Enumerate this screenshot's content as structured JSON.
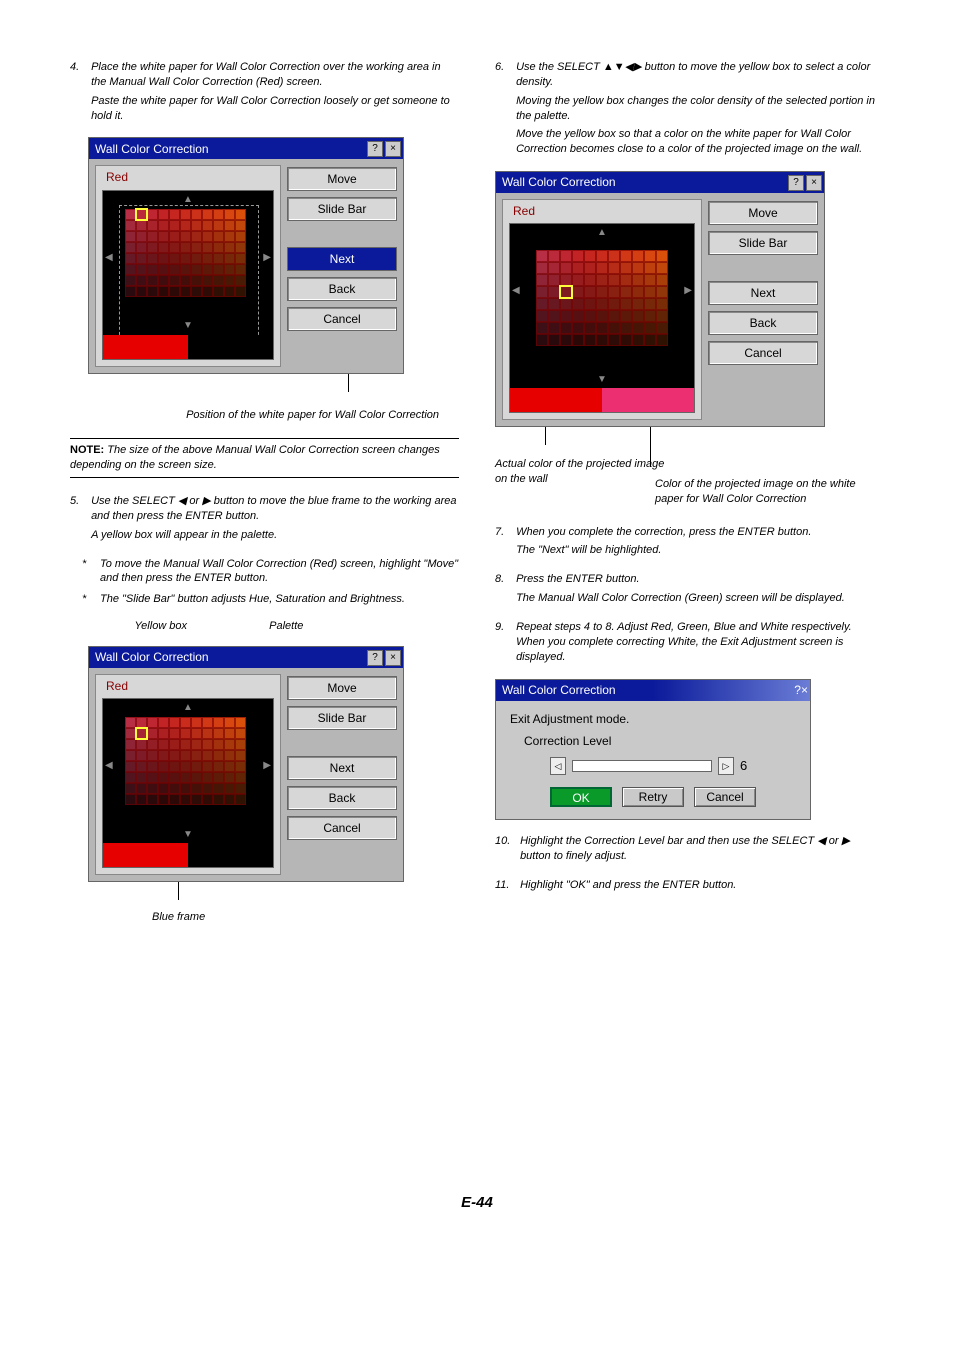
{
  "page_footer": "E-44",
  "col1": {
    "step4": {
      "num": "4.",
      "p1": "Place the white paper for Wall Color Correction over the working area in the Manual Wall Color Correction (Red) screen.",
      "p2": "Paste the white paper for Wall Color Correction loosely or get someone to hold it."
    },
    "fig1_caption": "Position of the white paper for Wall Color Correction",
    "note": {
      "bold": "NOTE:",
      "text": "The size of the above Manual Wall Color Correction screen changes depending on the screen size."
    },
    "step5": {
      "num": "5.",
      "p1": "Use the SELECT ◀ or ▶ button to move the blue frame to the working area and then press the ENTER button.",
      "p2": "A yellow box will appear in the palette.",
      "b1": "To move the Manual Wall Color Correction (Red) screen, highlight \"Move\" and then press the ENTER button.",
      "b2": "The \"Slide Bar\" button adjusts Hue, Saturation and Brightness."
    },
    "fig2_labels": {
      "yellow": "Yellow box",
      "palette": "Palette"
    },
    "fig2_caption": "Blue frame"
  },
  "col2": {
    "step6": {
      "num": "6.",
      "p1": "Use the SELECT ▲▼◀▶ button to move the yellow box to select a color density.",
      "p2": "Moving the yellow box changes the color density of the selected portion in the palette.",
      "p3": "Move the yellow box so that a color on the white paper for Wall Color Correction becomes close to a color of the projected image on the wall."
    },
    "fig3_cap_left": "Actual color of the projected image on the wall",
    "fig3_cap_right": "Color of the projected image on the white paper for Wall Color Correction",
    "step7": {
      "num": "7.",
      "p1": "When you complete the correction, press the ENTER button.",
      "p2": "The \"Next\" will be highlighted."
    },
    "step8": {
      "num": "8.",
      "p1": "Press the ENTER button.",
      "p2": "The Manual Wall Color Correction (Green) screen will be displayed."
    },
    "step9": {
      "num": "9.",
      "p1": "Repeat steps 4 to 8. Adjust Red, Green, Blue and White respectively. When you complete correcting White, the Exit Adjustment screen is displayed."
    },
    "step10": {
      "num": "10.",
      "p1": "Highlight the Correction Level bar and then use the SELECT ◀ or ▶ button to finely adjust."
    },
    "step11": {
      "num": "11.",
      "p1": "Highlight \"OK\" and press the ENTER button."
    }
  },
  "dlg": {
    "title": "Wall Color Correction",
    "red": "Red",
    "btns": {
      "move": "Move",
      "slidebar": "Slide Bar",
      "next": "Next",
      "back": "Back",
      "cancel": "Cancel"
    },
    "icons": {
      "help": "?",
      "close": "×"
    }
  },
  "dlg2": {
    "title": "Wall Color Correction",
    "exit": "Exit Adjustment mode.",
    "corr": "Correction Level",
    "val": "6",
    "ok": "OK",
    "retry": "Retry",
    "cancel": "Cancel"
  }
}
